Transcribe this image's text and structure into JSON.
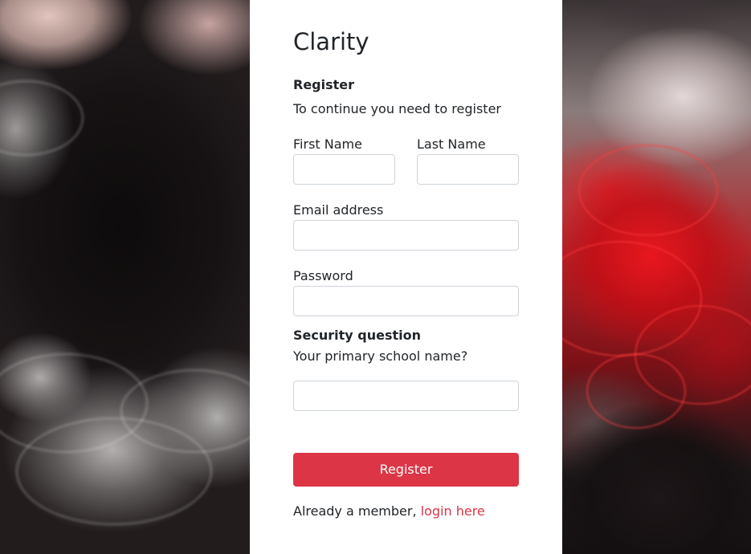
{
  "brand": {
    "name": "Clarity"
  },
  "register": {
    "heading": "Register",
    "subtitle": "To continue you need to register"
  },
  "fields": {
    "first_name": {
      "label": "First Name",
      "value": "",
      "placeholder": ""
    },
    "last_name": {
      "label": "Last Name",
      "value": "",
      "placeholder": ""
    },
    "email": {
      "label": "Email address",
      "value": "",
      "placeholder": ""
    },
    "password": {
      "label": "Password",
      "value": "",
      "placeholder": ""
    }
  },
  "security": {
    "heading": "Security question",
    "question": "Your primary school name?",
    "answer_value": "",
    "answer_placeholder": ""
  },
  "actions": {
    "register_label": "Register",
    "login_prompt": "Already a member,",
    "login_link": "login here"
  },
  "colors": {
    "accent": "#dc3545",
    "card_background": "#ffffff",
    "input_border": "#ced4da",
    "text": "#212529"
  }
}
